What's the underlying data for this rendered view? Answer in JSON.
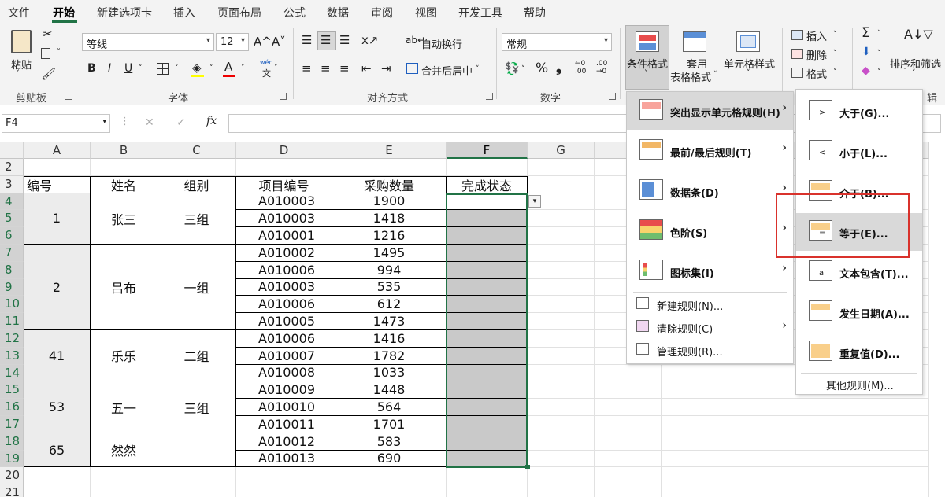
{
  "menubar": {
    "tabs": [
      "文件",
      "开始",
      "新建选项卡",
      "插入",
      "页面布局",
      "公式",
      "数据",
      "审阅",
      "视图",
      "开发工具",
      "帮助"
    ],
    "active": "开始"
  },
  "ribbon": {
    "clipboard": {
      "paste": "粘贴",
      "group": "剪贴板"
    },
    "font": {
      "name": "等线",
      "size": "12",
      "group": "字体",
      "grow": "A^",
      "shrink": "A˅",
      "bold": "B",
      "italic": "I",
      "underline": "U",
      "wen": "wén",
      "wen_sub": "文"
    },
    "align": {
      "wrap": "自动换行",
      "merge": "合并后居中",
      "group": "对齐方式"
    },
    "number": {
      "format": "常规",
      "group": "数字",
      "percent": "%",
      "comma": "❟",
      "inc": "←0 .00",
      "dec": ".00 →0"
    },
    "styles": {
      "cond_format": "条件格式",
      "table_format_1": "套用",
      "table_format_2": "表格格式",
      "cell_style": "单元格样式"
    },
    "cells": {
      "insert": "插入",
      "delete": "删除",
      "format": "格式"
    },
    "editing": {
      "sort_filter": "排序和筛选",
      "group_partial": "辑"
    }
  },
  "formula": {
    "namebox": "F4",
    "cancel": "✕",
    "enter": "✓",
    "fx": "fx"
  },
  "sheet": {
    "columns": [
      "A",
      "B",
      "C",
      "D",
      "E",
      "F",
      "G"
    ],
    "rows": [
      "2",
      "3",
      "4",
      "5",
      "6",
      "7",
      "8",
      "9",
      "10",
      "11",
      "12",
      "13",
      "14",
      "15",
      "16",
      "17",
      "18",
      "19",
      "20",
      "21"
    ],
    "headers": [
      "编号",
      "姓名",
      "组别",
      "项目编号",
      "采购数量",
      "完成状态"
    ],
    "groups": [
      {
        "id": "1",
        "name": "张三",
        "team": "三组"
      },
      {
        "id": "2",
        "name": "吕布",
        "team": "一组"
      },
      {
        "id": "41",
        "name": "乐乐",
        "team": "二组"
      },
      {
        "id": "53",
        "name": "五一",
        "team": "三组"
      },
      {
        "id": "65",
        "name": "然然",
        "team": ""
      }
    ],
    "items": [
      {
        "code": "A010003",
        "qty": "1900"
      },
      {
        "code": "A010003",
        "qty": "1418"
      },
      {
        "code": "A010001",
        "qty": "1216"
      },
      {
        "code": "A010002",
        "qty": "1495"
      },
      {
        "code": "A010006",
        "qty": "994"
      },
      {
        "code": "A010003",
        "qty": "535"
      },
      {
        "code": "A010006",
        "qty": "612"
      },
      {
        "code": "A010005",
        "qty": "1473"
      },
      {
        "code": "A010006",
        "qty": "1416"
      },
      {
        "code": "A010007",
        "qty": "1782"
      },
      {
        "code": "A010008",
        "qty": "1033"
      },
      {
        "code": "A010009",
        "qty": "1448"
      },
      {
        "code": "A010010",
        "qty": "564"
      },
      {
        "code": "A010011",
        "qty": "1701"
      },
      {
        "code": "A010012",
        "qty": "583"
      },
      {
        "code": "A010013",
        "qty": "690"
      }
    ]
  },
  "cf_menu": {
    "items": [
      "突出显示单元格规则(H)",
      "最前/最后规则(T)",
      "数据条(D)",
      "色阶(S)",
      "图标集(I)"
    ],
    "sub": [
      "新建规则(N)...",
      "清除规则(C)",
      "管理规则(R)..."
    ]
  },
  "highlight_menu": {
    "items": [
      "大于(G)...",
      "小于(L)...",
      "介于(B)...",
      "等于(E)...",
      "文本包含(T)...",
      "发生日期(A)...",
      "重复值(D)..."
    ],
    "other": "其他规则(M)..."
  },
  "colors": {
    "accent": "#217346",
    "highlight_box": "#d9322c",
    "selected_fill": "#c9c9c9"
  }
}
